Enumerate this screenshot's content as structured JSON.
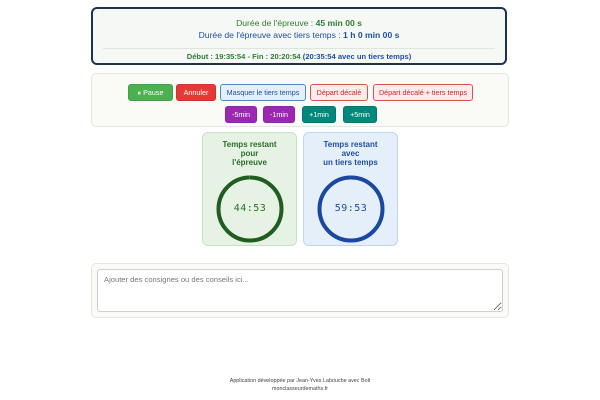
{
  "info": {
    "duration_label": "Durée de l'épreuve : ",
    "duration_value": "45 min 00 s",
    "duration_tiers_label": "Durée de l'épreuve avec tiers temps : ",
    "duration_tiers_value": "1 h 0 min 00 s",
    "schedule": "Début : 19:35:54 - Fin : 20:20:54",
    "schedule_tiers": "(20:35:54 avec un tiers temps)"
  },
  "controls": {
    "pause": "⏸ Pause",
    "cancel": "Annuler",
    "hide_tiers": "Masquer le tiers temps",
    "offset_start": "Départ décalé",
    "offset_start_tiers": "Départ décalé + tiers temps",
    "minus5": "-5min",
    "minus1": "-1min",
    "plus1": "+1min",
    "plus5": "+5min"
  },
  "timers": {
    "normal": {
      "title_1": "Temps restant",
      "title_2": "pour",
      "title_3": "l'épreuve",
      "value": "44:53",
      "progress": 0.997,
      "color": "#1f5e20"
    },
    "tiers": {
      "title_1": "Temps restant",
      "title_2": "avec",
      "title_3": "un tiers temps",
      "value": "59:53",
      "progress": 0.998,
      "color": "#1a47a0"
    }
  },
  "notes": {
    "placeholder": "Ajouter des consignes ou des conseils ici..."
  },
  "footer": {
    "line1": "Application développée par Jean-Yves Labouche avec Bolt",
    "line2": "monclasseurdemaths.fr"
  }
}
